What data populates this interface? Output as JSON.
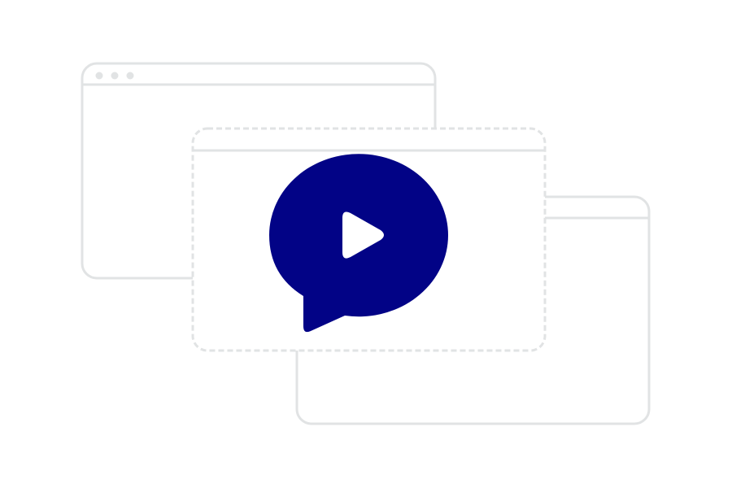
{
  "colors": {
    "background": "#ffffff",
    "window_outline": "#e1e3e4",
    "bubble_fill": "#020386",
    "play_glyph": "#ffffff"
  },
  "windows": [
    {
      "name": "back-window",
      "has_traffic_dots": true,
      "border_style": "solid"
    },
    {
      "name": "middle-window",
      "has_traffic_dots": false,
      "border_style": "dashed"
    },
    {
      "name": "front-window",
      "has_traffic_dots": false,
      "border_style": "solid"
    }
  ],
  "icon": {
    "semantic": "video-chat-bubble-icon",
    "inner": "play-icon"
  }
}
